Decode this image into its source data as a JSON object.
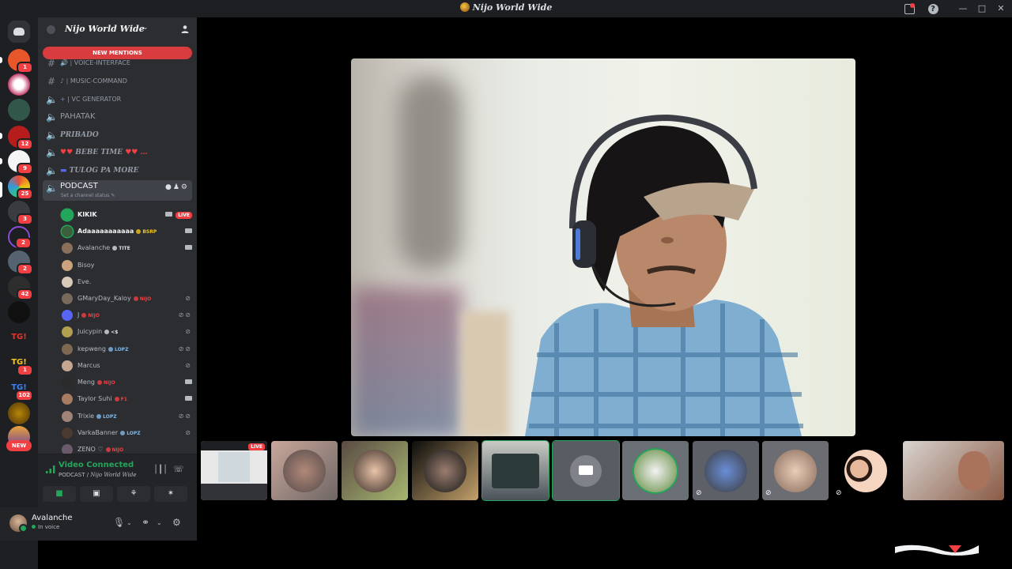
{
  "window": {
    "title": "Nijo World Wide"
  },
  "server": {
    "name": "Nijo World Wide",
    "new_mentions": "NEW MENTIONS"
  },
  "rail": {
    "badges": [
      "1",
      "12",
      "9",
      "25",
      "3",
      "2",
      "2",
      "42",
      "1",
      "102"
    ],
    "new_label": "NEW"
  },
  "channels": [
    {
      "name": "VOICE-INTERFACE",
      "type": "text"
    },
    {
      "name": "MUSIC-COMMAND",
      "type": "text"
    },
    {
      "name": "VC GENERATOR",
      "type": "voice"
    },
    {
      "name": "PAHATAK",
      "type": "voice"
    },
    {
      "name": "PRIBADO",
      "type": "voice"
    },
    {
      "name": "BEBE TIME",
      "type": "voice"
    },
    {
      "name": "TULOG PA MORE",
      "type": "voice"
    }
  ],
  "active_channel": {
    "name": "PODCAST",
    "status_prompt": "Set a channel status"
  },
  "voice_users": [
    {
      "name": "KIKIK",
      "tag": "",
      "live": "LIVE",
      "icons": "cam"
    },
    {
      "name": "Adaaaaaaaaaaa",
      "tag": "BSRP",
      "icons": "cam"
    },
    {
      "name": "Avalanche",
      "tag": "TITE",
      "icons": "cam"
    },
    {
      "name": "Bisoy",
      "tag": "",
      "icons": ""
    },
    {
      "name": "Eve.",
      "tag": "",
      "icons": ""
    },
    {
      "name": "GMaryDay_Kaloy",
      "tag": "NIJO",
      "icons": "muted"
    },
    {
      "name": "J",
      "tag": "NIJO",
      "icons": "muted-deaf"
    },
    {
      "name": "Juicypin",
      "tag": "<$",
      "icons": "muted"
    },
    {
      "name": "kepweng",
      "tag": "LOPZ",
      "icons": "muted-deaf"
    },
    {
      "name": "Marcus",
      "tag": "",
      "icons": "muted"
    },
    {
      "name": "Meng",
      "tag": "NIJO",
      "icons": "cam"
    },
    {
      "name": "Taylor Suhi",
      "tag": "F1",
      "icons": "cam"
    },
    {
      "name": "Trixie",
      "tag": "LOPZ",
      "icons": "muted-deaf"
    },
    {
      "name": "VarkaBanner",
      "tag": "LOPZ",
      "icons": "muted"
    },
    {
      "name": "ZENO ♡",
      "tag": "NIJO",
      "icons": ""
    }
  ],
  "voice_panel": {
    "status": "Video Connected",
    "location_channel": "PODCAST",
    "location_server": "Nijo World Wide"
  },
  "user_panel": {
    "name": "Avalanche",
    "status": "In voice"
  },
  "strip": {
    "live_label": "LIVE"
  },
  "colors": {
    "accent_green": "#23a55a",
    "danger_red": "#f23f43",
    "sidebar_bg": "#2b2d31",
    "rail_bg": "#1e1f22"
  }
}
